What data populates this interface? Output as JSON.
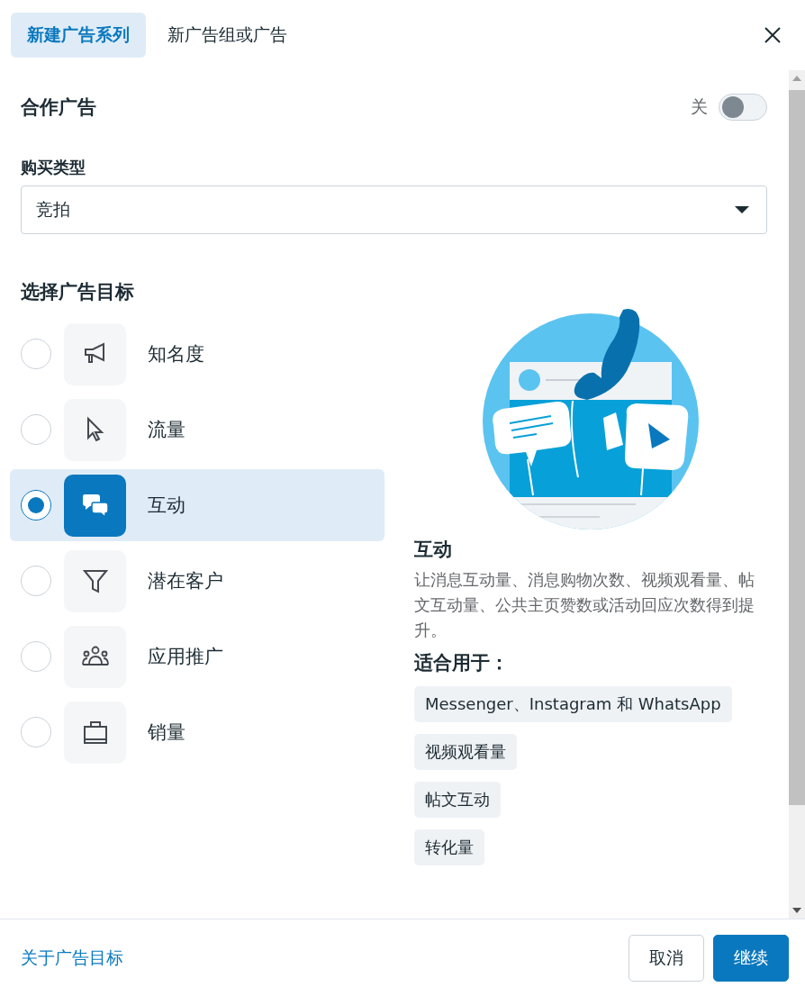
{
  "tabs": [
    {
      "label": "新建广告系列",
      "selected": true
    },
    {
      "label": "新广告组或广告",
      "selected": false
    }
  ],
  "partnership": {
    "title": "合作广告",
    "state_label": "关",
    "on": false
  },
  "buy_type": {
    "label": "购买类型",
    "value": "竞拍"
  },
  "objective": {
    "title": "选择广告目标",
    "options": [
      {
        "label": "知名度",
        "kind": "megaphone",
        "selected": false
      },
      {
        "label": "流量",
        "kind": "cursor",
        "selected": false
      },
      {
        "label": "互动",
        "kind": "chat",
        "selected": true
      },
      {
        "label": "潜在客户",
        "kind": "funnel",
        "selected": false
      },
      {
        "label": "应用推广",
        "kind": "people",
        "selected": false
      },
      {
        "label": "销量",
        "kind": "bag",
        "selected": false
      }
    ]
  },
  "detail": {
    "title": "互动",
    "description": "让消息互动量、消息购物次数、视频观看量、帖文互动量、公共主页赞数或活动回应次数得到提升。",
    "suited_title": "适合用于：",
    "tags": [
      "Messenger、Instagram 和 WhatsApp",
      "视频观看量",
      "帖文互动",
      "转化量"
    ]
  },
  "footer": {
    "link": "关于广告目标",
    "buttons": [
      {
        "label": "取消",
        "kind": "secondary"
      },
      {
        "label": "继续",
        "kind": "primary"
      }
    ]
  }
}
